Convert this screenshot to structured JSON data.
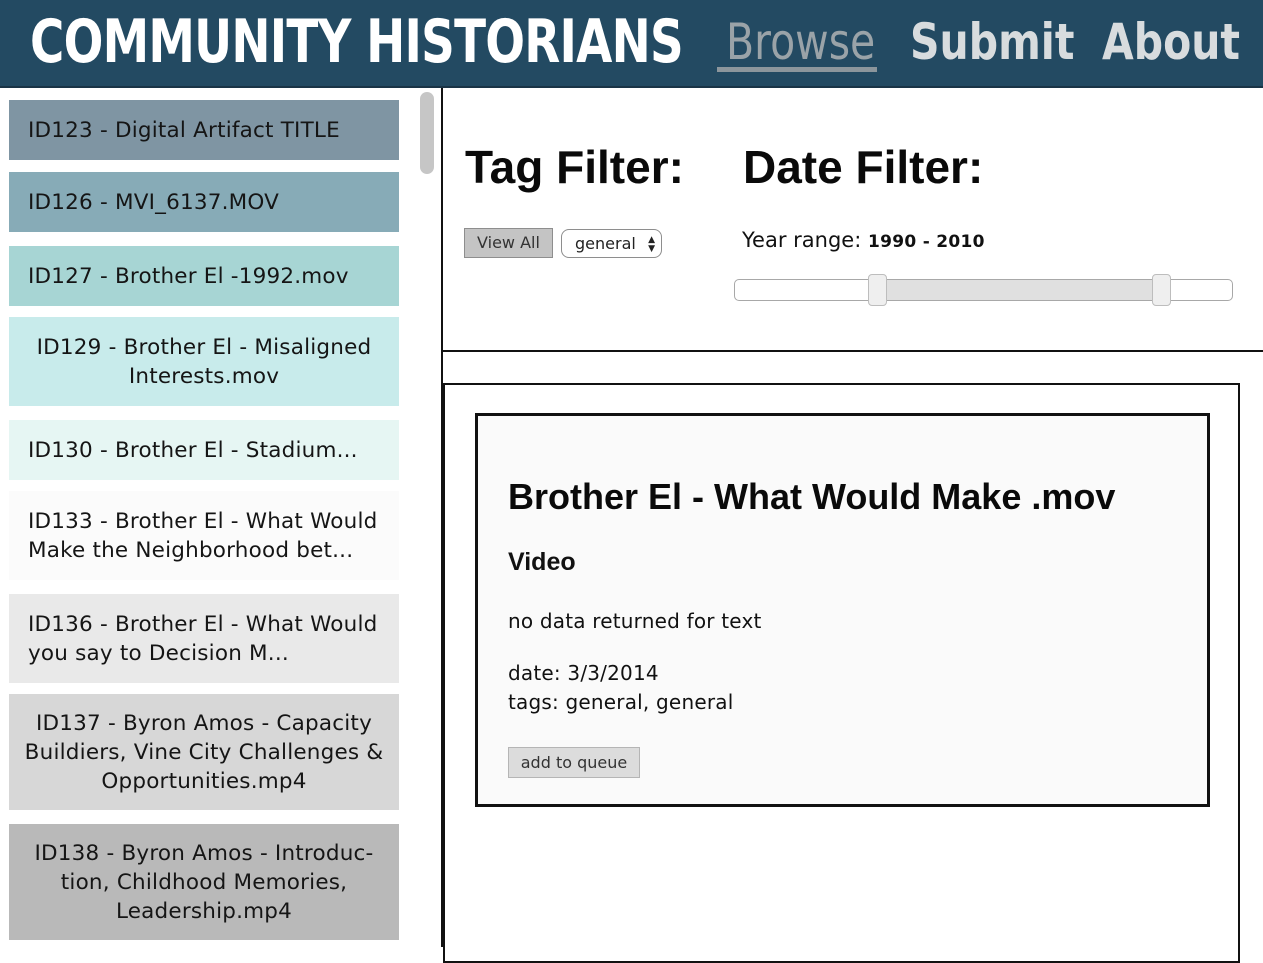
{
  "header": {
    "brand": "COMMUNITY HISTORIANS",
    "nav": {
      "browse": "Browse",
      "submit": "Submit",
      "about": "About"
    }
  },
  "sidebar": {
    "items": [
      {
        "label": "ID123 - Digital Artifact TITLE",
        "color": "#7f95a3"
      },
      {
        "label": "ID126 - MVI_6137.MOV",
        "color": "#87abb7"
      },
      {
        "label": "ID127 - Brother El -1992.mov",
        "color": "#a7d5d4"
      },
      {
        "label": "ID129 - Brother El - Misaligned Interests.mov",
        "color": "#c8ebeb"
      },
      {
        "label": "ID130 - Brother El - Stadium...",
        "color": "#e6f6f3"
      },
      {
        "label": "ID133 - Brother El - What Would Make the Neighborhood bet...",
        "color": "#fbfbfb"
      },
      {
        "label": "ID136 - Brother El - What Would you say to Decision M...",
        "color": "#e9e9e9"
      },
      {
        "label": "ID137 - Byron Amos - Capacity Buildiers, Vine City Challenges & Opportunities.mp4",
        "color": "#d7d7d7"
      },
      {
        "label": "ID138 - Byron Amos - Introduc-tion, Childhood Memories, Leadership.mp4",
        "color": "#b9b9b9"
      }
    ]
  },
  "filters": {
    "tag_title": "Tag Filter:",
    "date_title": "Date Filter:",
    "view_all_label": "View All",
    "tag_selected": "general",
    "year_range_label": "Year range:",
    "year_range_value": "1990 - 2010",
    "year_min": 1990,
    "year_max": 2010
  },
  "result": {
    "title": "Brother El - What Would Make .mov",
    "type": "Video",
    "text": "no data returned for text",
    "date": "date: 3/3/2014",
    "tags": "tags: general, general",
    "queue_label": "add to queue"
  }
}
